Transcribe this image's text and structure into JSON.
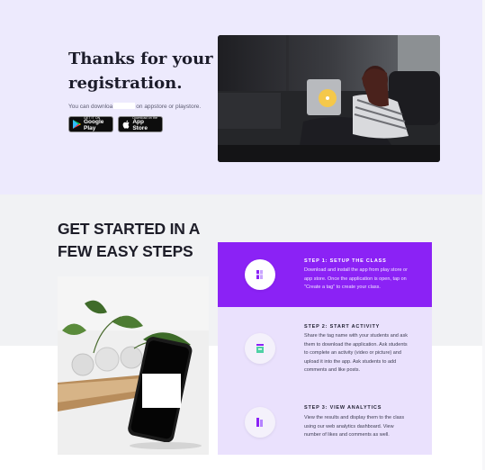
{
  "hero": {
    "title": "Thanks for your registration.",
    "subtitle_before": "You can downloa",
    "subtitle_after": "on appstore or playstore.",
    "google_play": {
      "small": "GET IT ON",
      "big": "Google Play"
    },
    "app_store": {
      "small": "Download on the",
      "big": "App Store"
    }
  },
  "steps": {
    "heading": "GET STARTED IN A FEW EASY STEPS",
    "items": [
      {
        "title": "STEP 1: SETUP THE CLASS",
        "description": "Download and install the app from play store or app store. Once the application is open, tap on \"Create a tag\" to create your class."
      },
      {
        "title": "STEP 2: START ACTIVITY",
        "description": "Share the tag name with your students and ask them to download the application. Ask students to complete an activity (video or picture) and upload it into the app. Ask students to add comments and like posts."
      },
      {
        "title": "STEP 3: VIEW ANALYTICS",
        "description": "View the results and display them to the class using our web analytics dashboard. View number of likes and comments as well."
      }
    ]
  },
  "colors": {
    "hero_bg": "#edeafd",
    "accent_purple": "#8b22f5",
    "step_light_bg": "#eae1fd",
    "section_bg": "#f1f2f4"
  }
}
